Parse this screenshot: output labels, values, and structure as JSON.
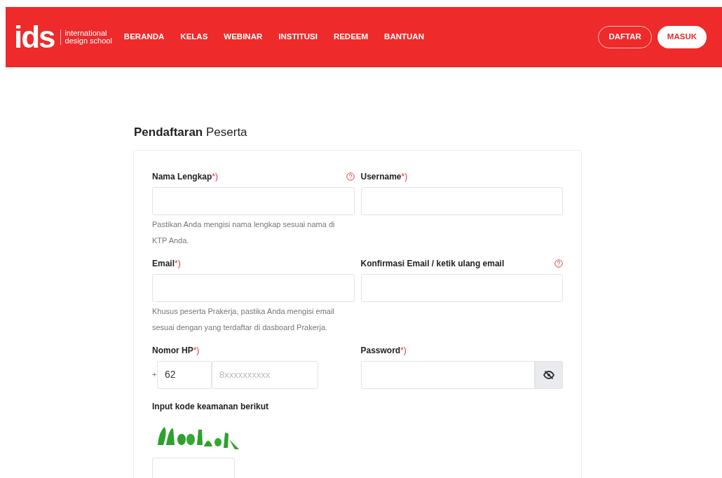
{
  "header": {
    "logo": {
      "mark": "ids",
      "tagline_1": "international",
      "tagline_2": "design school"
    },
    "nav": [
      "BERANDA",
      "KELAS",
      "WEBINAR",
      "INSTITUSI",
      "REDEEM",
      "BANTUAN"
    ],
    "buttons": [
      {
        "label": "DAFTAR",
        "kind": "outline"
      },
      {
        "label": "MASUK",
        "kind": "solid"
      }
    ]
  },
  "form": {
    "title_bold": "Pendaftaran",
    "title_rest": "Peserta",
    "required_mark": "*)",
    "fields": [
      {
        "kind": "text",
        "label": "Nama Lengkap",
        "required": true,
        "help": true,
        "hint": "Pastikan Anda mengisi nama lengkap sesuai nama di KTP Anda."
      },
      {
        "kind": "text",
        "label": "Username",
        "required": true,
        "help": false
      },
      {
        "kind": "text",
        "label": "Email",
        "required": true,
        "help": false,
        "hint": "Khusus peserta Prakerja, pastika Anda mengisi email sesuai dengan yang terdaftar di dasboard Prakerja."
      },
      {
        "kind": "text",
        "label": "Konfirmasi Email / ketik ulang email",
        "required": false,
        "help": true
      },
      {
        "kind": "phone",
        "label": "Nomor HP",
        "required": true,
        "help": false,
        "prefix": "+",
        "code": "62",
        "placeholder": "8xxxxxxxxxx"
      },
      {
        "kind": "password",
        "label": "Password",
        "required": true,
        "help": false
      }
    ],
    "captcha": {
      "label": "Input kode keamanan berikut"
    }
  }
}
